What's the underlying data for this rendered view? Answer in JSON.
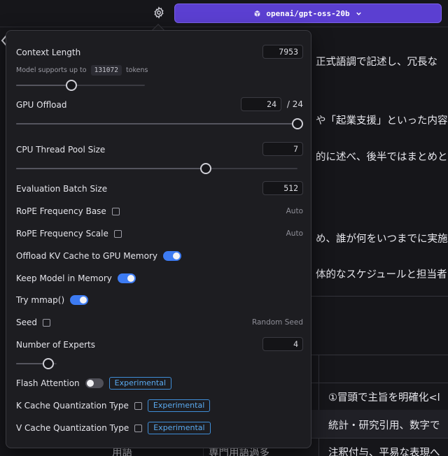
{
  "header": {
    "model_name": "openai/gpt-oss-20b",
    "model_icon": "cube-icon",
    "settings_icon": "gear-icon",
    "dropdown_icon": "chevron-down-icon"
  },
  "background": {
    "lines": [
      "正式語調で記述し、冗長な",
      "や「起業支援」といった内容",
      "的に述べ、後半ではまとめと",
      "め、誰が何をいつまでに実施",
      "体的なスケジュールと担当者"
    ],
    "table": {
      "cells": [
        "①冒頭で主旨を明確化<l",
        "統計・研究引用、数字で",
        "用語",
        "専門用語過多",
        "注釈付与、平易な表現へ"
      ]
    }
  },
  "settings": {
    "context_length": {
      "label": "Context Length",
      "value": "7953",
      "hint_prefix": "Model supports up to",
      "hint_value": "131072",
      "hint_suffix": "tokens",
      "slider_fraction": 0.43
    },
    "gpu_offload": {
      "label": "GPU Offload",
      "value": "24",
      "max_label": "/ 24",
      "slider_fraction": 1.0
    },
    "cpu_thread_pool": {
      "label": "CPU Thread Pool Size",
      "value": "7",
      "slider_fraction": 0.675
    },
    "eval_batch": {
      "label": "Evaluation Batch Size",
      "value": "512"
    },
    "rope_base": {
      "label": "RoPE Frequency Base",
      "note": "Auto"
    },
    "rope_scale": {
      "label": "RoPE Frequency Scale",
      "note": "Auto"
    },
    "offload_kv": {
      "label": "Offload KV Cache to GPU Memory",
      "on": true
    },
    "keep_in_memory": {
      "label": "Keep Model in Memory",
      "on": true
    },
    "mmap": {
      "label": "Try mmap()",
      "on": true
    },
    "seed": {
      "label": "Seed",
      "note": "Random Seed"
    },
    "experts": {
      "label": "Number of Experts",
      "value": "4",
      "slider_fraction": 0.25
    },
    "flash_attention": {
      "label": "Flash Attention",
      "on": false,
      "badge": "Experimental"
    },
    "k_cache": {
      "label": "K Cache Quantization Type",
      "badge": "Experimental"
    },
    "v_cache": {
      "label": "V Cache Quantization Type",
      "badge": "Experimental"
    }
  },
  "colors": {
    "accent": "#5b3fd1",
    "toggle_on": "#3d7bf2",
    "badge": "#5aaaf0"
  }
}
